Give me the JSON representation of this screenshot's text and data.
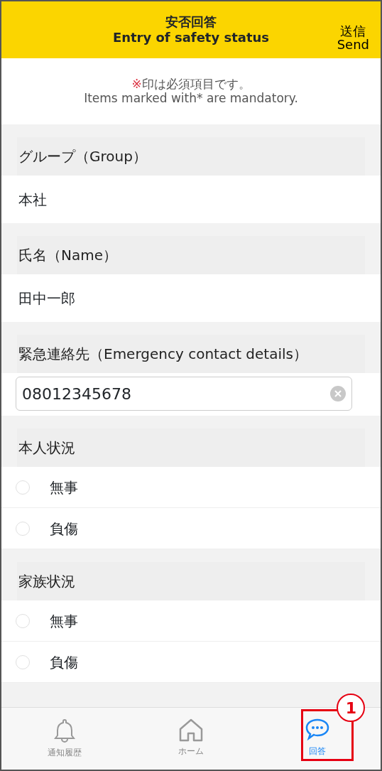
{
  "header": {
    "title": "安否回答",
    "subtitle": "Entry of safety status",
    "action_jp": "送信",
    "action_en": "Send"
  },
  "notice": {
    "mark": "※",
    "text_jp": "印は必須項目です。",
    "text_en": "Items marked with* are mandatory."
  },
  "sections": [
    {
      "kind": "text",
      "label": "グループ（Group）",
      "value": "本社"
    },
    {
      "kind": "text",
      "label": "氏名（Name）",
      "value": "田中一郎"
    },
    {
      "kind": "input",
      "label": "緊急連絡先（Emergency contact details）",
      "value": "08012345678"
    },
    {
      "kind": "radio",
      "label": "本人状況",
      "options": [
        {
          "label": "無事",
          "selected": false
        },
        {
          "label": "負傷",
          "selected": false
        }
      ]
    },
    {
      "kind": "radio",
      "label": "家族状況",
      "options": [
        {
          "label": "無事",
          "selected": false
        },
        {
          "label": "負傷",
          "selected": false
        }
      ]
    }
  ],
  "tabs": [
    {
      "kind": "bell",
      "label": "通知履歴",
      "selected": false
    },
    {
      "kind": "home",
      "label": "ホーム",
      "selected": false
    },
    {
      "kind": "chat",
      "label": "回答",
      "selected": true
    }
  ],
  "annotation": {
    "label": "1"
  }
}
